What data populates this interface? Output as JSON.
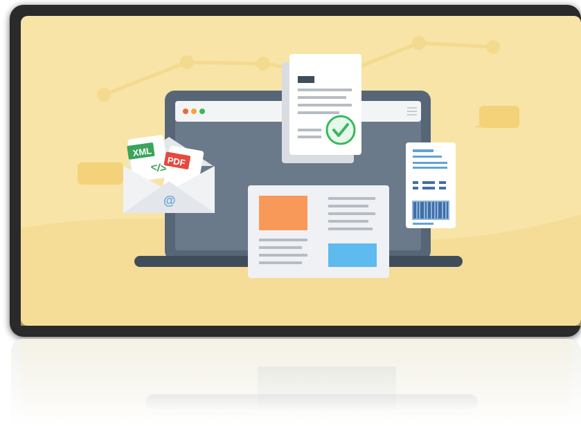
{
  "labels": {
    "xml": "XML",
    "pdf": "PDF",
    "code": "</>",
    "at": "@"
  },
  "colors": {
    "background": "#f7e4a6",
    "frame": "#2a2a2a",
    "laptop": "#566677",
    "orange": "#f8995a",
    "blue": "#5fbaf0",
    "green": "#37b95d",
    "pdf_red": "#e8483d",
    "xml_green": "#3aa45a"
  },
  "icons": [
    "envelope-icon",
    "xml-file-icon",
    "pdf-file-icon",
    "checkmark-icon",
    "barcode-icon",
    "hamburger-menu-icon"
  ]
}
